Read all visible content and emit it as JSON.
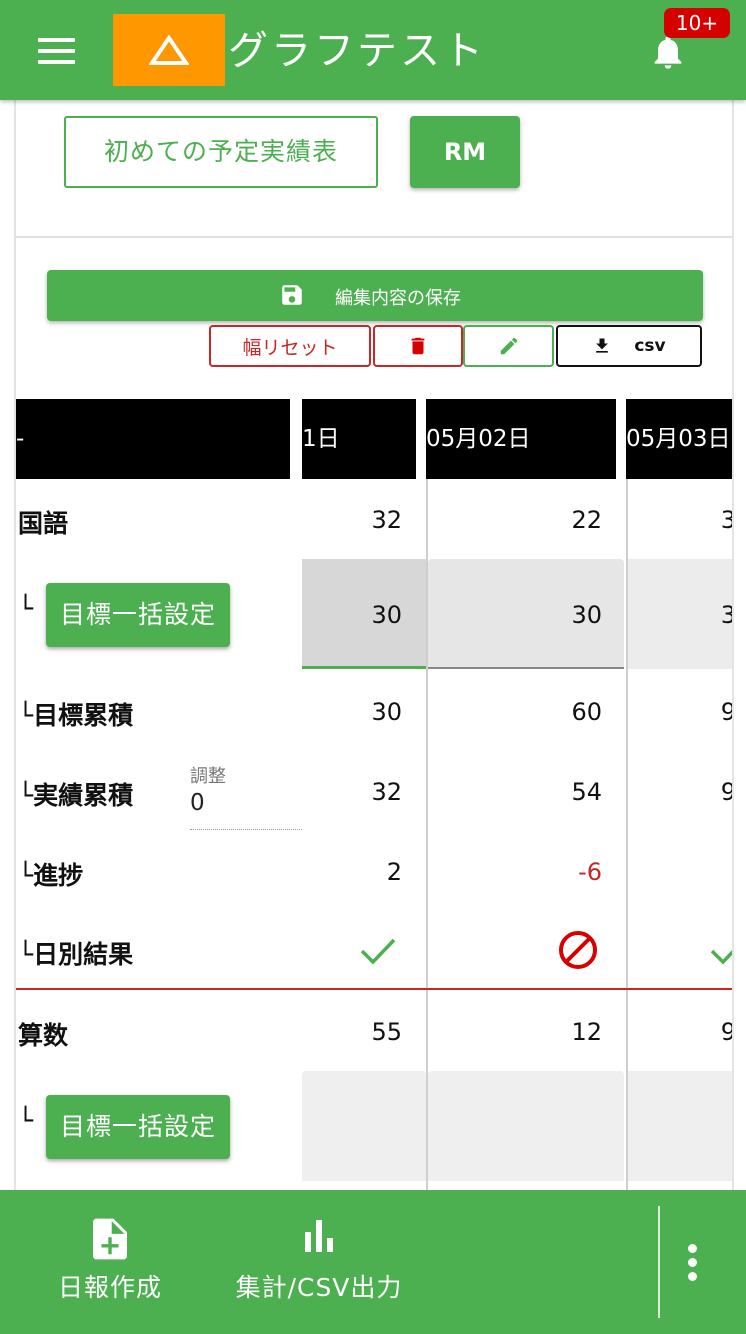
{
  "header": {
    "title": "グラフテスト",
    "notification_badge": "10+",
    "accent_color": "#4caf50",
    "logo_color": "#ff9800"
  },
  "toolbar": {
    "schedule_button": "初めての予定実績表",
    "rm_button": "RM",
    "save_button": "編集内容の保存",
    "reset_width_button": "幅リセット",
    "csv_button": "csv"
  },
  "table": {
    "header": {
      "label": "-",
      "dates": [
        "1日",
        "05月02日",
        "05月03日"
      ]
    },
    "subjects": [
      {
        "name": "国語",
        "values": [
          "32",
          "22",
          "3"
        ],
        "target_button": "目標一括設定",
        "target_values": [
          "30",
          "30",
          "3"
        ],
        "rows": [
          {
            "label": "目標累積",
            "values": [
              "30",
              "60",
              "9"
            ]
          },
          {
            "label": "実績累積",
            "values": [
              "32",
              "54",
              "9"
            ]
          },
          {
            "label": "進捗",
            "values": [
              "2",
              "-6",
              ""
            ]
          },
          {
            "label": "日別結果",
            "results": [
              "check",
              "prohibited",
              "check"
            ]
          }
        ],
        "adjust_label": "調整",
        "adjust_value": "0"
      },
      {
        "name": "算数",
        "values": [
          "55",
          "12",
          "9"
        ],
        "target_button": "目標一括設定"
      }
    ],
    "corner_mark": "└"
  },
  "bottom_nav": {
    "report": "日報作成",
    "stats": "集計/CSV出力"
  }
}
